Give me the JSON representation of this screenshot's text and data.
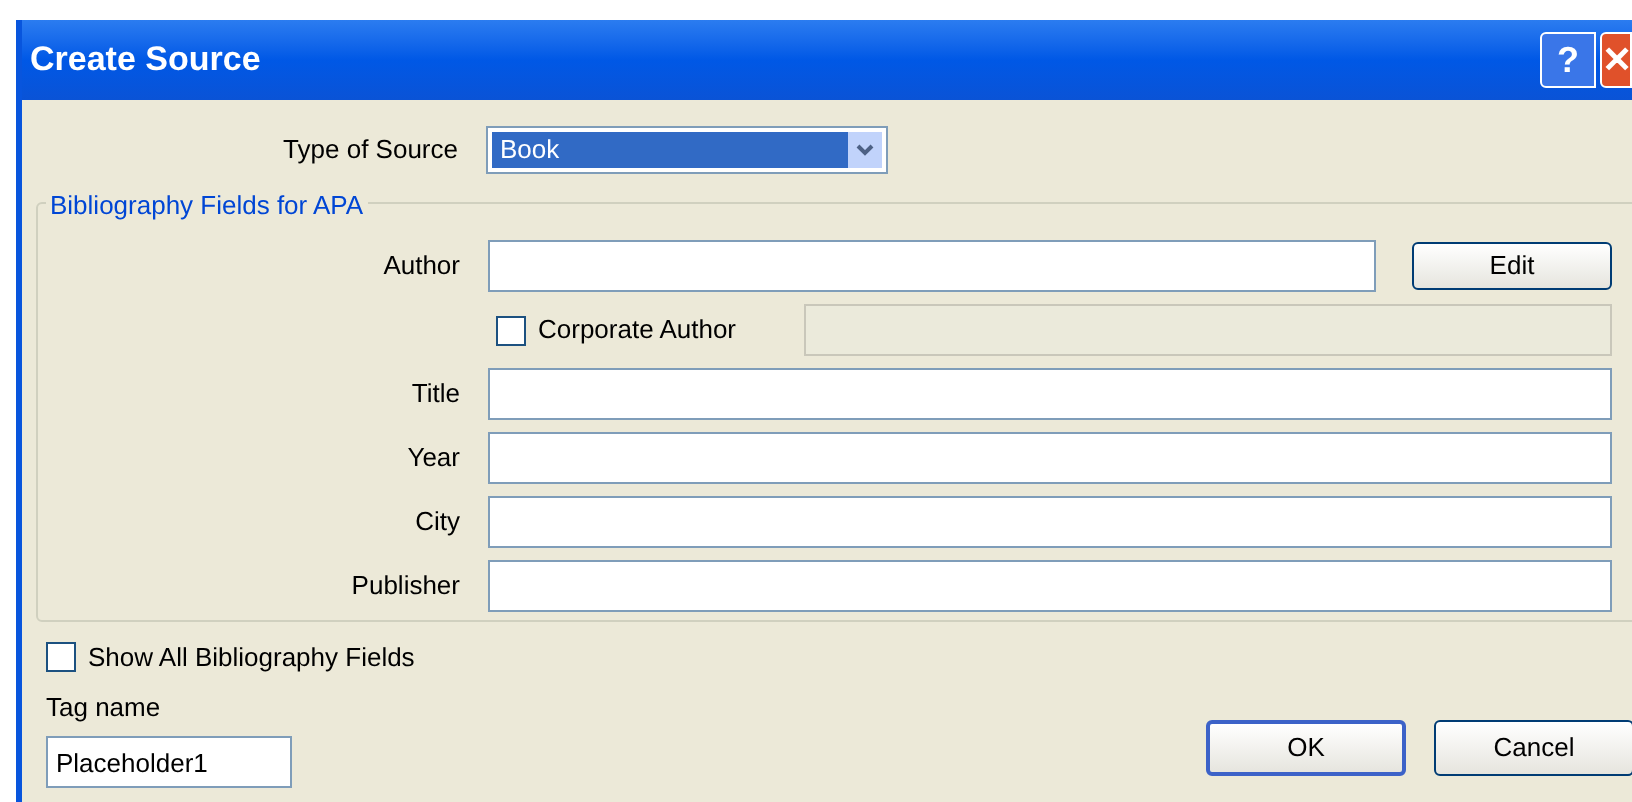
{
  "window": {
    "title": "Create Source",
    "buttons": [
      {
        "kind": "help",
        "label": "?"
      },
      {
        "kind": "close",
        "label": "✕"
      }
    ]
  },
  "type_of_source": {
    "label": "Type of Source",
    "value": "Book"
  },
  "group": {
    "title": "Bibliography Fields for APA",
    "author": {
      "label": "Author",
      "button": "Edit"
    },
    "corporate_author": {
      "label": "Corporate Author",
      "checked": false
    },
    "fields": [
      {
        "label": "Title"
      },
      {
        "label": "Year"
      },
      {
        "label": "City"
      },
      {
        "label": "Publisher"
      }
    ]
  },
  "show_all": {
    "label": "Show All Bibliography Fields",
    "checked": false
  },
  "tag_name": {
    "label": "Tag name",
    "value": "Placeholder1"
  },
  "buttons": [
    {
      "label": "OK",
      "default": true
    },
    {
      "label": "Cancel",
      "default": false
    }
  ]
}
